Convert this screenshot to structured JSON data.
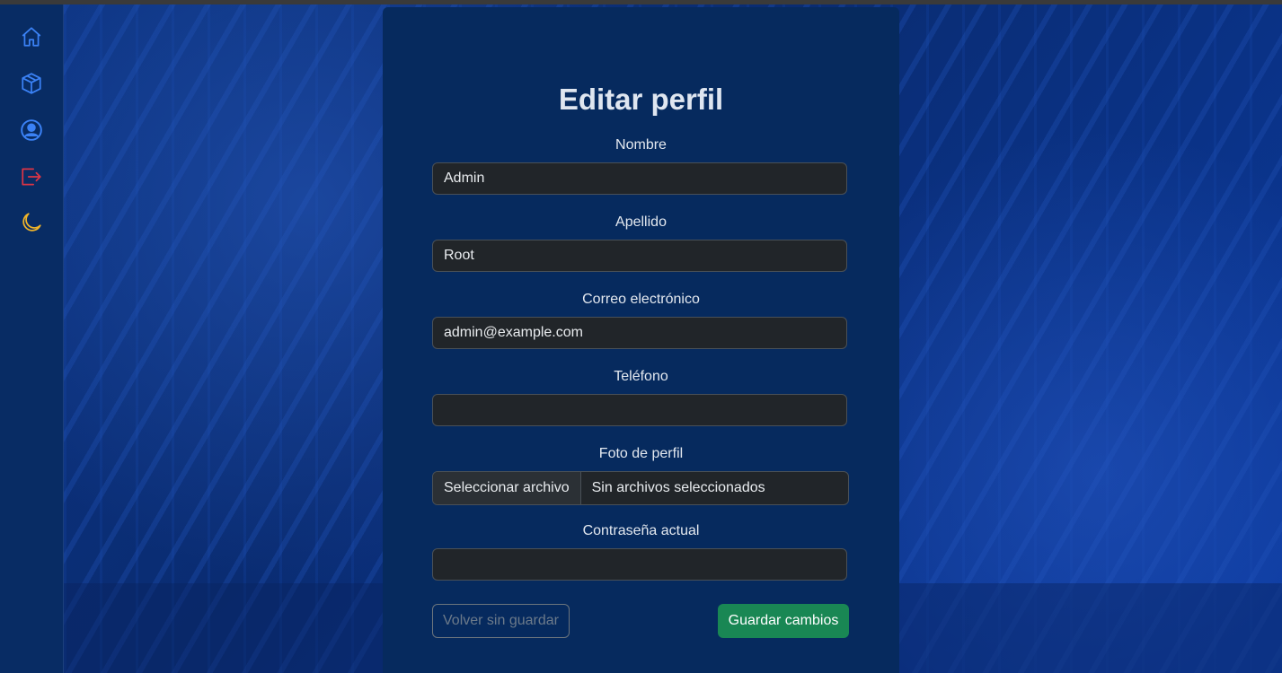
{
  "sidebar": {
    "icons": [
      {
        "name": "home-icon",
        "color": "#3b82f6"
      },
      {
        "name": "box-icon",
        "color": "#3b82f6"
      },
      {
        "name": "user-circle-icon",
        "color": "#3b82f6"
      },
      {
        "name": "logout-icon",
        "color": "#dc3545"
      },
      {
        "name": "moon-icon",
        "color": "#f0b429"
      }
    ]
  },
  "form": {
    "title": "Editar perfil",
    "fields": {
      "nombre": {
        "label": "Nombre",
        "value": "Admin"
      },
      "apellido": {
        "label": "Apellido",
        "value": "Root"
      },
      "correo": {
        "label": "Correo electrónico",
        "value": "admin@example.com"
      },
      "telefono": {
        "label": "Teléfono",
        "value": ""
      },
      "foto": {
        "label": "Foto de perfil",
        "button": "Seleccionar archivo",
        "status": "Sin archivos seleccionados"
      },
      "password": {
        "label": "Contraseña actual",
        "value": ""
      }
    },
    "back_button": "Volver sin guardar",
    "save_button": "Guardar cambios"
  },
  "colors": {
    "card_bg": "#062a5e",
    "input_bg": "#212529",
    "save_bg": "#198754"
  }
}
